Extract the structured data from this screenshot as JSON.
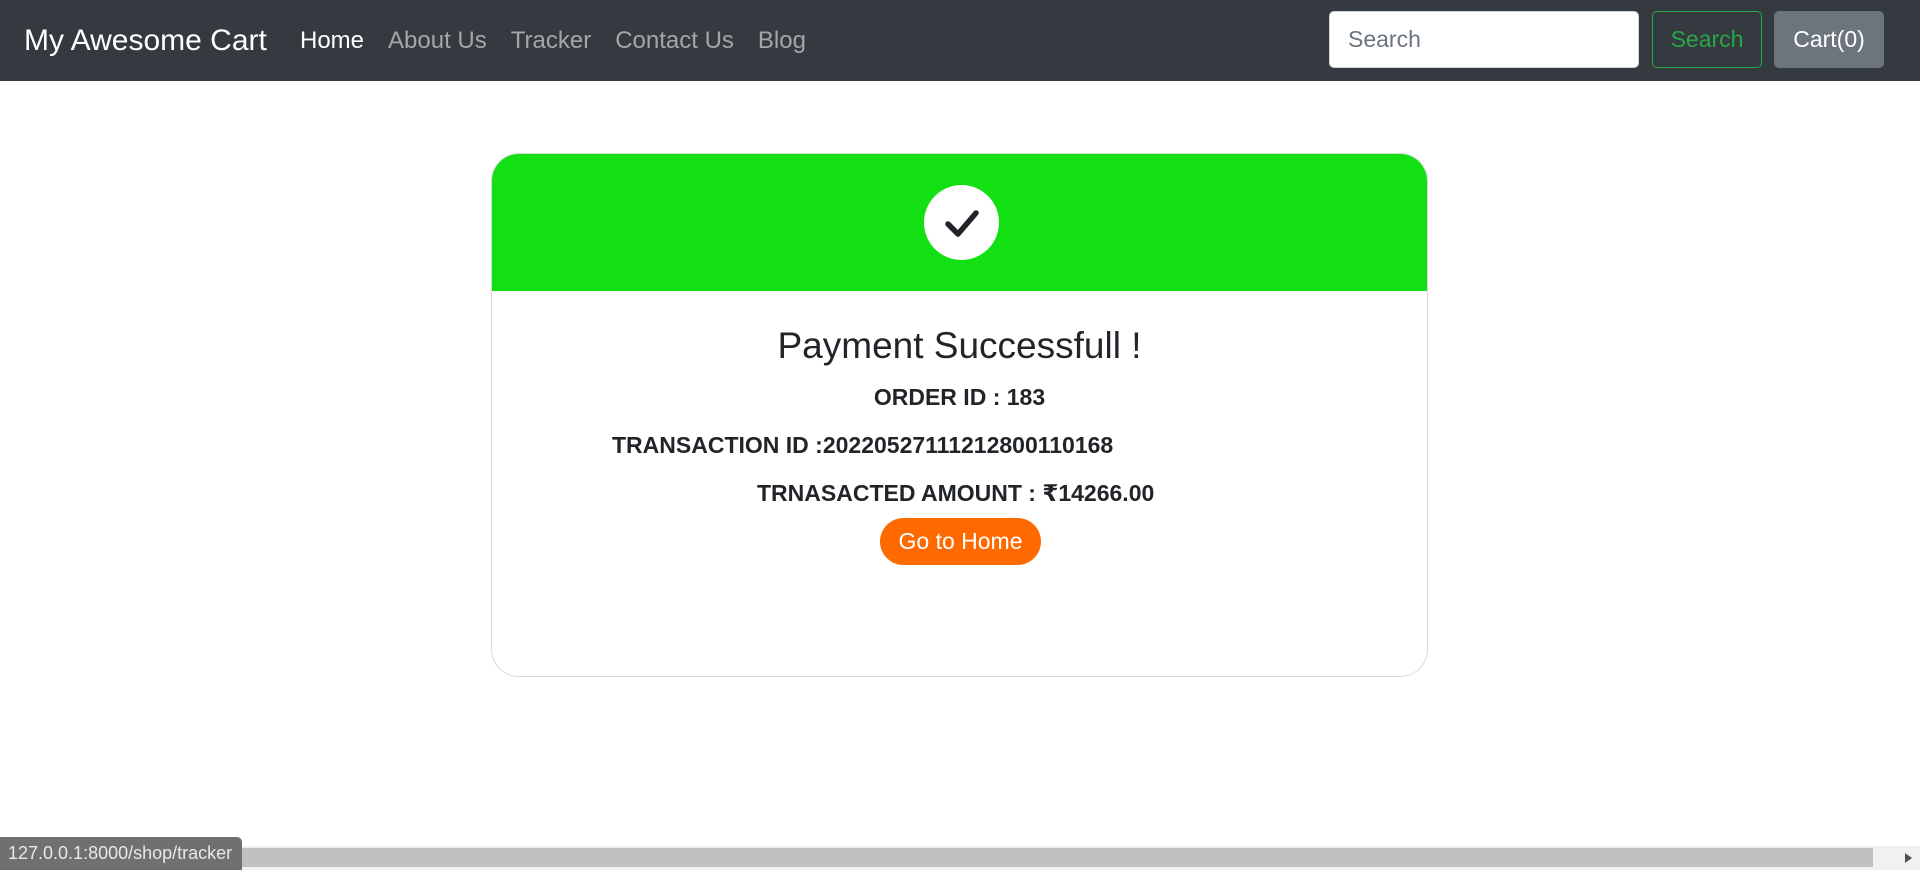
{
  "navbar": {
    "brand": "My Awesome Cart",
    "links": [
      {
        "label": "Home",
        "active": true
      },
      {
        "label": "About Us"
      },
      {
        "label": "Tracker"
      },
      {
        "label": "Contact Us"
      },
      {
        "label": "Blog"
      }
    ],
    "search_placeholder": "Search",
    "search_button_label": "Search",
    "cart_label": "Cart(0)"
  },
  "card": {
    "icon": "check-icon",
    "title": "Payment Successfull !",
    "order_id": "ORDER ID : 183",
    "transaction_id": "TRANSACTION ID :20220527111212800110168",
    "amount": "TRNASACTED AMOUNT : ₹14266.00",
    "home_button_label": "Go to Home"
  },
  "status_bar": {
    "url": "127.0.0.1:8000/shop/tracker"
  },
  "colors": {
    "navbar_bg": "#343a40",
    "header_green": "#12e012",
    "button_orange": "#ff6a00",
    "search_green": "#28a745",
    "cart_gray": "#6c757d"
  }
}
